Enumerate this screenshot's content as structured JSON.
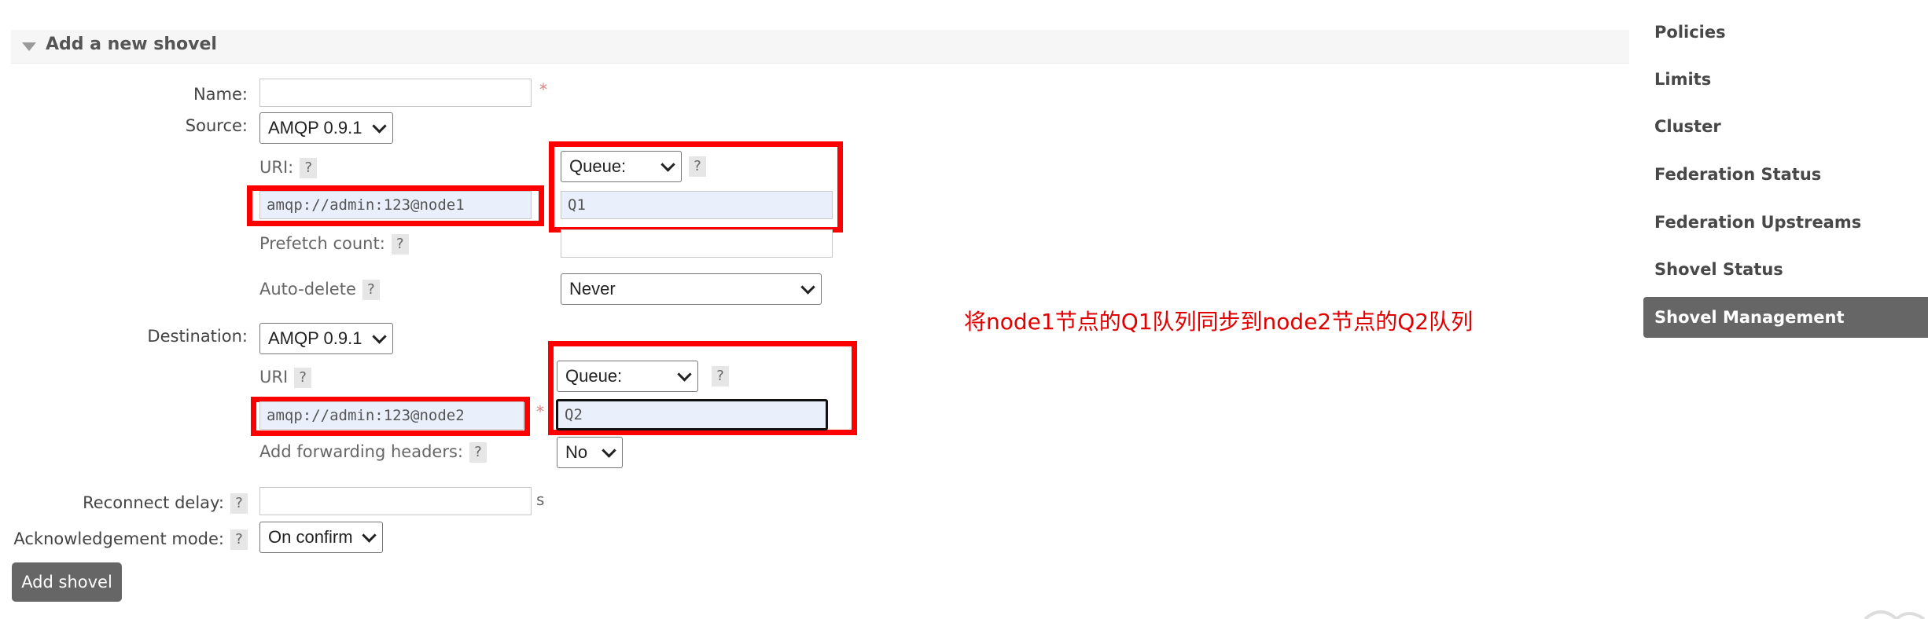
{
  "panel": {
    "title": "Add a new shovel"
  },
  "form": {
    "name_label": "Name:",
    "name_value": "",
    "required_mark": "*",
    "source_label": "Source:",
    "source_protocol": "AMQP 0.9.1",
    "source_uri_label": "URI:",
    "source_uri_value": "amqp://admin:123@node1",
    "source_type": "Queue:",
    "source_queue_value": "Q1",
    "prefetch_label": "Prefetch count:",
    "prefetch_value": "",
    "autodelete_label": "Auto-delete",
    "autodelete_value": "Never",
    "destination_label": "Destination:",
    "dest_protocol": "AMQP 0.9.1",
    "dest_uri_label": "URI",
    "dest_uri_value": "amqp://admin:123@node2",
    "dest_type": "Queue:",
    "dest_queue_value": "Q2",
    "fwd_headers_label": "Add forwarding headers:",
    "fwd_headers_value": "No",
    "reconnect_label": "Reconnect delay:",
    "reconnect_value": "",
    "reconnect_unit": "s",
    "ack_label": "Acknowledgement mode:",
    "ack_value": "On confirm",
    "help": "?",
    "submit_label": "Add shovel"
  },
  "annotation": "将node1节点的Q1队列同步到node2节点的Q2队列",
  "sidebar": {
    "items": [
      "Policies",
      "Limits",
      "Cluster",
      "Federation Status",
      "Federation Upstreams",
      "Shovel Status"
    ],
    "active": "Shovel Management"
  },
  "colors": {
    "highlight": "#ff0000",
    "annotation_text": "#e00000",
    "active_nav": "#666666"
  }
}
